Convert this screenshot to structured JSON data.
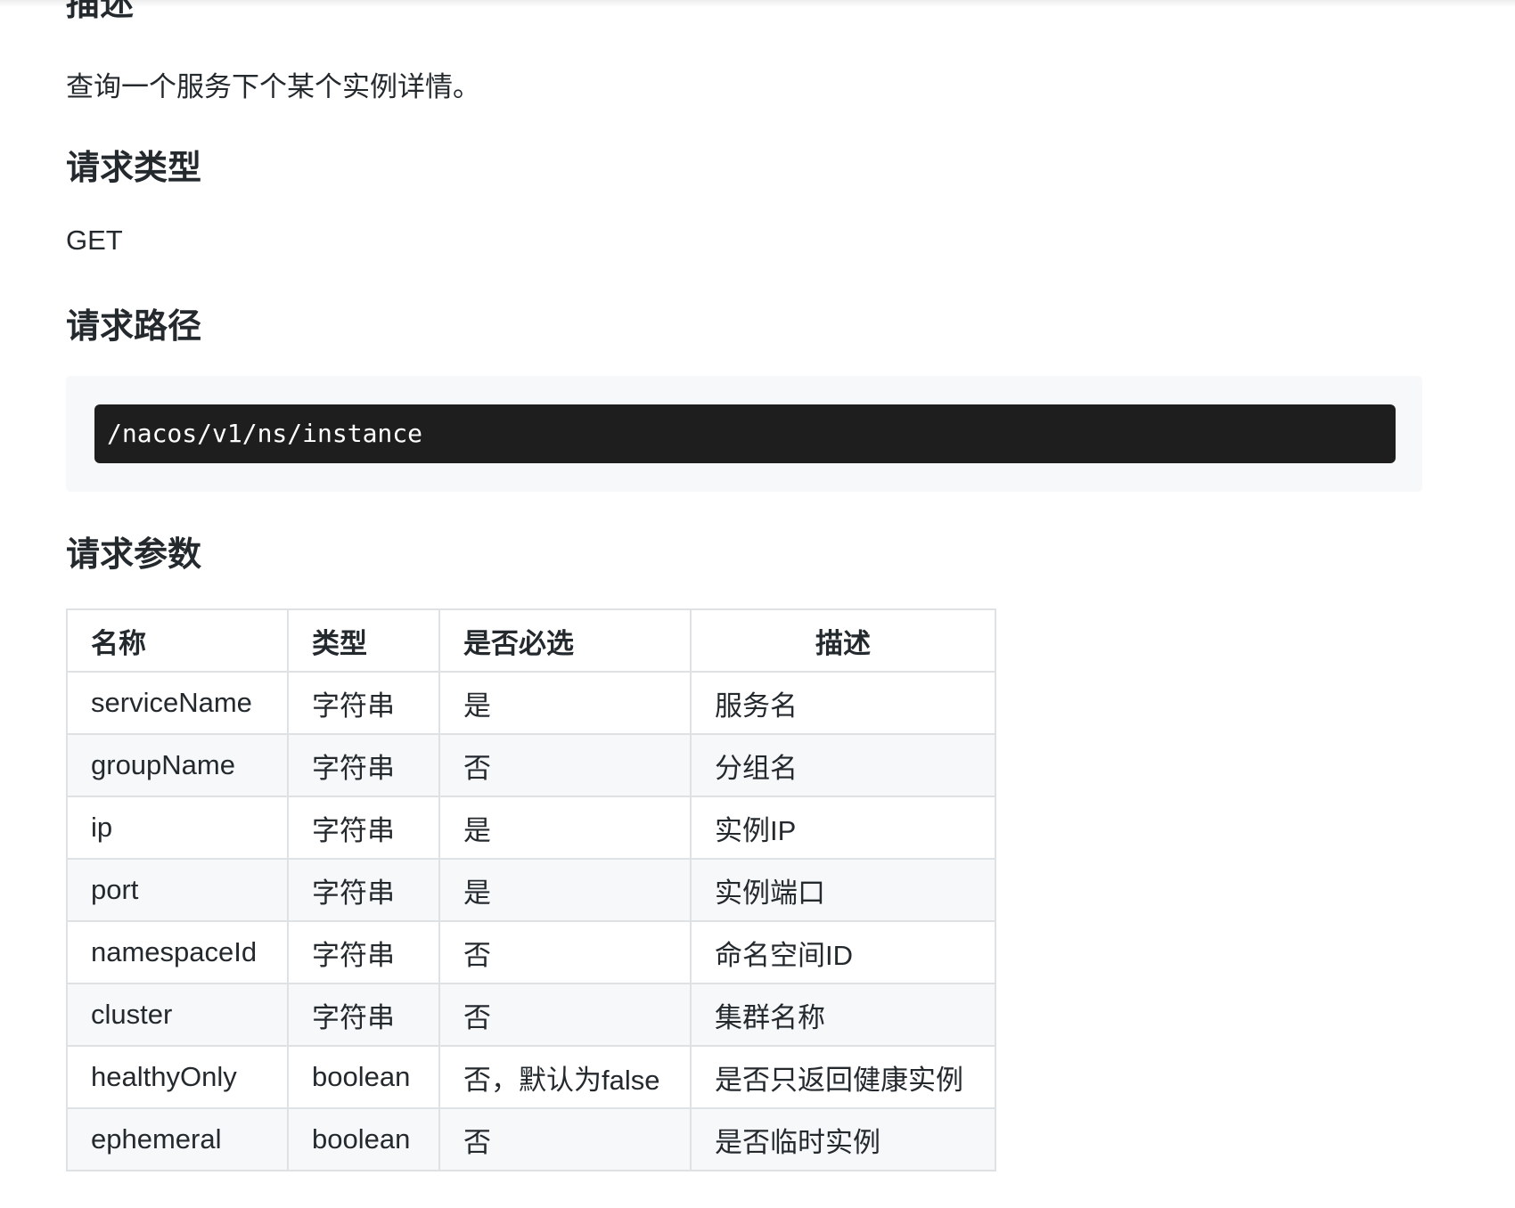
{
  "sections": {
    "description_heading": "描述",
    "description_text": "查询一个服务下个某个实例详情。",
    "request_type_heading": "请求类型",
    "request_type_value": "GET",
    "request_path_heading": "请求路径",
    "request_path_value": "/nacos/v1/ns/instance",
    "request_params_heading": "请求参数"
  },
  "params_table": {
    "headers": [
      "名称",
      "类型",
      "是否必选",
      "描述"
    ],
    "rows": [
      [
        "serviceName",
        "字符串",
        "是",
        "服务名"
      ],
      [
        "groupName",
        "字符串",
        "否",
        "分组名"
      ],
      [
        "ip",
        "字符串",
        "是",
        "实例IP"
      ],
      [
        "port",
        "字符串",
        "是",
        "实例端口"
      ],
      [
        "namespaceId",
        "字符串",
        "否",
        "命名空间ID"
      ],
      [
        "cluster",
        "字符串",
        "否",
        "集群名称"
      ],
      [
        "healthyOnly",
        "boolean",
        "否，默认为false",
        "是否只返回健康实例"
      ],
      [
        "ephemeral",
        "boolean",
        "否",
        "是否临时实例"
      ]
    ]
  },
  "colors": {
    "code_background": "#1e1e1e",
    "code_wrapper": "#f6f8fa",
    "table_border": "#dfe2e5",
    "zebra_row": "#f6f8fa",
    "text": "#24292e"
  }
}
